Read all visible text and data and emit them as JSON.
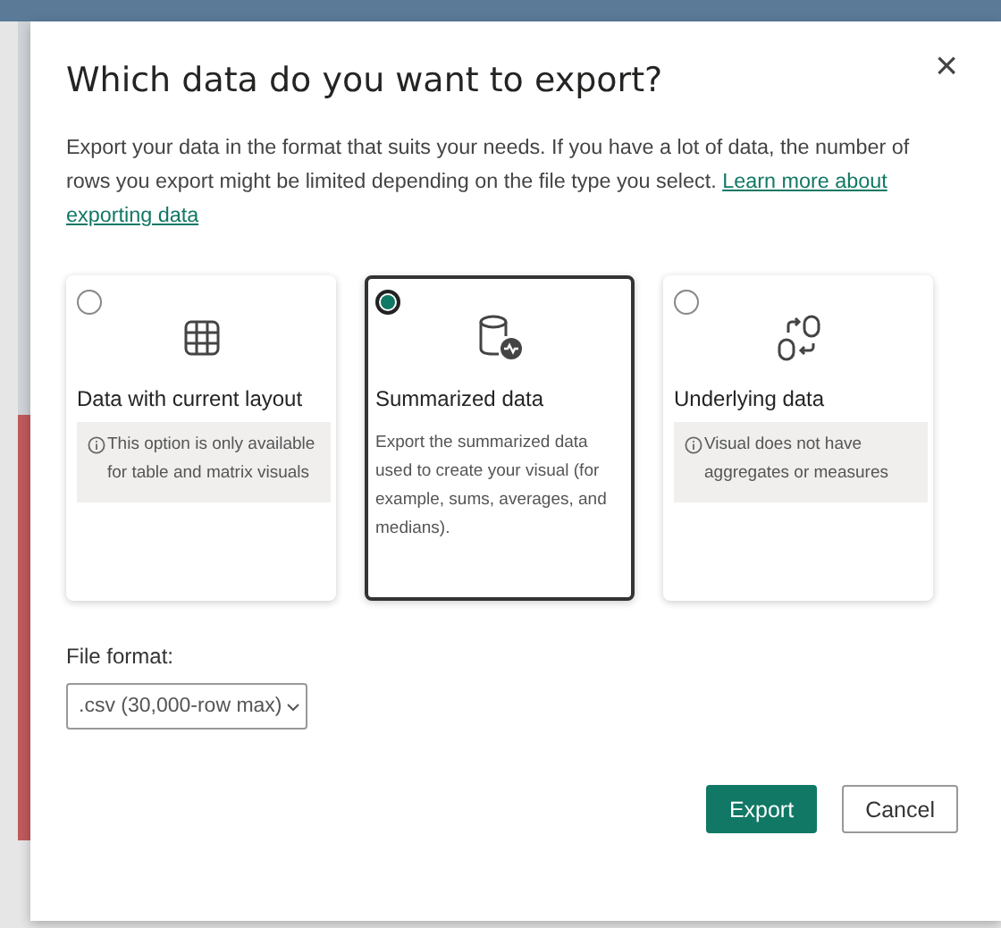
{
  "dialog": {
    "title": "Which data do you want to export?",
    "close": "×",
    "intro": "Export your data in the format that suits your needs. If you have a lot of data, the number of rows you export might be limited depending on the file type you select.",
    "link": [
      "Learn more about",
      "exporting data"
    ]
  },
  "options": [
    {
      "title": "Data with current layout",
      "selected": false,
      "kind": "note",
      "text": "This option is only available for table and matrix visuals"
    },
    {
      "title": "Summarized data",
      "selected": true,
      "kind": "description",
      "text": "Export the summarized data used to create your visual (for example, sums, averages, and medians)."
    },
    {
      "title": "Underlying data",
      "selected": false,
      "kind": "note",
      "text": "Visual does not have aggregates or measures"
    }
  ],
  "file_format": {
    "label": "File format:",
    "value": ".csv (30,000-row max)"
  },
  "buttons": [
    {
      "label": "Export",
      "kind": "primary"
    },
    {
      "label": "Cancel",
      "kind": "secondary"
    }
  ]
}
